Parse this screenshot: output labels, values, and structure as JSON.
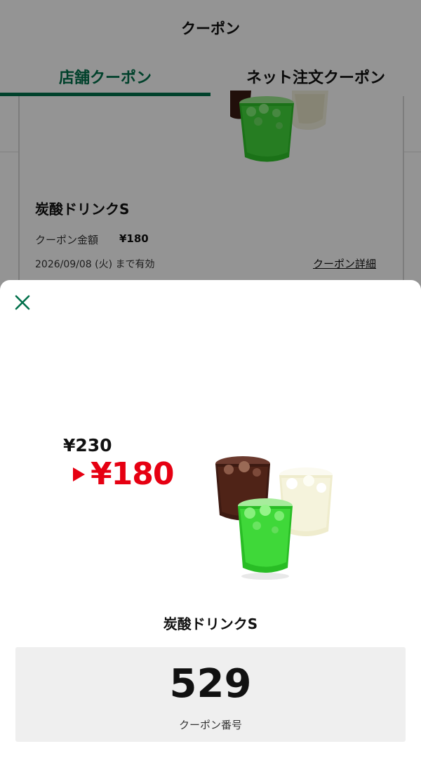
{
  "header": {
    "title": "クーポン"
  },
  "tabs": [
    {
      "label": "店舗クーポン",
      "active": true
    },
    {
      "label": "ネット注文クーポン",
      "active": false
    }
  ],
  "card": {
    "title": "炭酸ドリンクS",
    "amount_label": "クーポン金額",
    "amount": "¥180",
    "expiry": "2026/09/08 (火) まで有効",
    "detail_link": "クーポン詳細"
  },
  "sheet": {
    "price_old": "¥230",
    "price_new": "¥180",
    "title": "炭酸ドリンクS",
    "code": "529",
    "code_label": "クーポン番号"
  },
  "colors": {
    "accent": "#00704a",
    "sale": "#e60012",
    "code_bg": "#efefef"
  },
  "icons": [
    "close-icon",
    "drink-image"
  ]
}
